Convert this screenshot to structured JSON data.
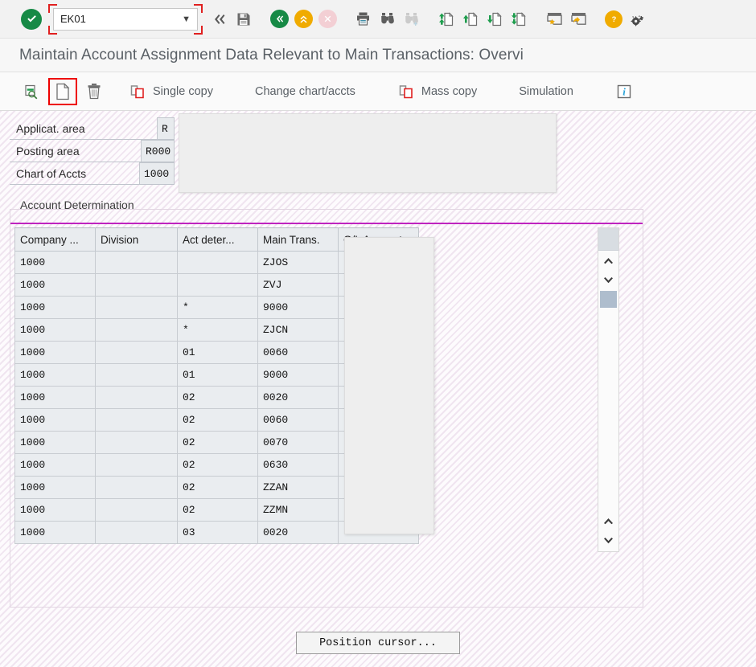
{
  "top_toolbar": {
    "ok_icon": "check-circle-icon",
    "command_field": {
      "value": "EK01",
      "placeholder": "",
      "dropdown_icon": "chevron-down-icon"
    },
    "icons": [
      {
        "name": "back-chevrons-icon",
        "label": "Back"
      },
      {
        "name": "save-icon",
        "label": "Save"
      },
      {
        "name": "back-circle-icon",
        "label": "Back"
      },
      {
        "name": "exit-up-circle-icon",
        "label": "Exit"
      },
      {
        "name": "cancel-circle-icon",
        "label": "Cancel"
      },
      {
        "name": "print-icon",
        "label": "Print"
      },
      {
        "name": "find-binoculars-icon",
        "label": "Find"
      },
      {
        "name": "find-next-binoculars-icon",
        "label": "Find Next"
      },
      {
        "name": "first-page-icon",
        "label": "First Page"
      },
      {
        "name": "previous-page-icon",
        "label": "Previous Page"
      },
      {
        "name": "next-page-icon",
        "label": "Next Page"
      },
      {
        "name": "last-page-icon",
        "label": "Last Page"
      },
      {
        "name": "create-favorite-icon",
        "label": "Create Session"
      },
      {
        "name": "generate-shortcut-icon",
        "label": "Create Shortcut"
      },
      {
        "name": "help-icon",
        "label": "Help"
      },
      {
        "name": "customize-gear-icon",
        "label": "Customize Local Layout"
      }
    ]
  },
  "title": "Maintain Account Assignment Data Relevant to Main Transactions: Overvi",
  "app_toolbar": {
    "items": [
      {
        "name": "display-change-icon",
        "label": "",
        "icon": "display-change-icon",
        "highlighted": false
      },
      {
        "name": "new-entries-button",
        "label": "",
        "icon": "new-document-icon",
        "highlighted": true
      },
      {
        "name": "delete-button",
        "label": "",
        "icon": "trash-icon",
        "highlighted": false
      },
      {
        "name": "single-copy-button",
        "label": "Single copy",
        "icon": "copy-icon",
        "highlighted": false
      },
      {
        "name": "change-chart-accts-button",
        "label": "Change chart/accts",
        "icon": "",
        "highlighted": false
      },
      {
        "name": "mass-copy-button",
        "label": "Mass copy",
        "icon": "copy-icon",
        "highlighted": false
      },
      {
        "name": "simulation-button",
        "label": "Simulation",
        "icon": "",
        "highlighted": false
      },
      {
        "name": "information-button",
        "label": "",
        "icon": "info-icon",
        "highlighted": false
      }
    ]
  },
  "form": {
    "fields": [
      {
        "label": "Applicat. area",
        "value": "R"
      },
      {
        "label": "Posting area",
        "value": "R000"
      },
      {
        "label": "Chart of Accts",
        "value": "1000"
      }
    ]
  },
  "section": {
    "title": "Account Determination",
    "accent_color": "#bf24bf"
  },
  "table": {
    "columns": [
      "Company ...",
      "Division",
      "Act deter...",
      "Main Trans.",
      "G/L Account"
    ],
    "rows": [
      [
        "1000",
        "",
        "",
        "ZJOS",
        ""
      ],
      [
        "1000",
        "",
        "",
        "ZVJ",
        ""
      ],
      [
        "1000",
        "",
        "*",
        "9000",
        ""
      ],
      [
        "1000",
        "",
        "*",
        "ZJCN",
        ""
      ],
      [
        "1000",
        "",
        "01",
        "0060",
        ""
      ],
      [
        "1000",
        "",
        "01",
        "9000",
        ""
      ],
      [
        "1000",
        "",
        "02",
        "0020",
        ""
      ],
      [
        "1000",
        "",
        "02",
        "0060",
        ""
      ],
      [
        "1000",
        "",
        "02",
        "0070",
        ""
      ],
      [
        "1000",
        "",
        "02",
        "0630",
        ""
      ],
      [
        "1000",
        "",
        "02",
        "ZZAN",
        ""
      ],
      [
        "1000",
        "",
        "02",
        "ZZMN",
        ""
      ],
      [
        "1000",
        "",
        "03",
        "0020",
        ""
      ]
    ],
    "scrollbar": {
      "up_icon": "chevron-up-icon",
      "down_icon": "chevron-down-icon",
      "page_up_icon": "chevron-up-icon",
      "page_down_icon": "chevron-down-icon"
    }
  },
  "footer": {
    "position_cursor_label": "Position cursor..."
  },
  "colors": {
    "accent_magenta": "#bf24bf",
    "green": "#178a46",
    "orange": "#f0ab00",
    "highlight_red": "#ee0000",
    "header_grey": "#e9ecef"
  }
}
